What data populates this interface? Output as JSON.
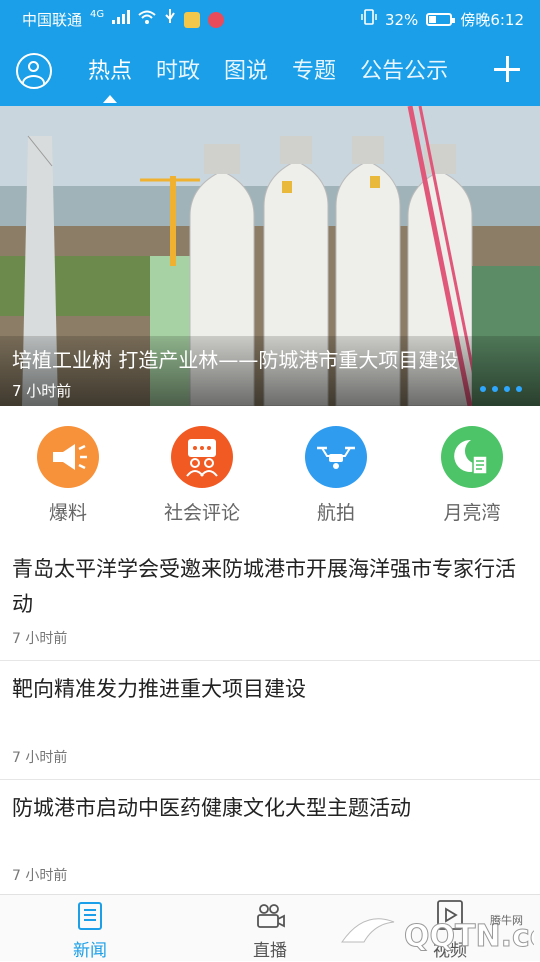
{
  "status_bar": {
    "carrier": "中国联通",
    "network": "4G",
    "battery": "32%",
    "battery_level": 0.32,
    "time": "傍晚6:12"
  },
  "nav": {
    "tabs": [
      {
        "label": "热点",
        "active": true
      },
      {
        "label": "时政",
        "active": false
      },
      {
        "label": "图说",
        "active": false
      },
      {
        "label": "专题",
        "active": false
      },
      {
        "label": "公告公示",
        "active": false
      }
    ]
  },
  "hero": {
    "title": "培植工业树 打造产业林——防城港市重大项目建设",
    "time": "7 小时前",
    "slides": 4
  },
  "quick_links": [
    {
      "label": "爆料",
      "icon": "megaphone-icon",
      "color": "#f7913a"
    },
    {
      "label": "社会评论",
      "icon": "comment-icon",
      "color": "#f25a24"
    },
    {
      "label": "航拍",
      "icon": "drone-icon",
      "color": "#2f9cf0"
    },
    {
      "label": "月亮湾",
      "icon": "moon-icon",
      "color": "#4cc467"
    }
  ],
  "news": [
    {
      "title": "青岛太平洋学会受邀来防城港市开展海洋强市专家行活动",
      "time": "7 小时前"
    },
    {
      "title": "靶向精准发力推进重大项目建设",
      "time": "7 小时前"
    },
    {
      "title": "防城港市启动中医药健康文化大型主题活动",
      "time": "7 小时前"
    }
  ],
  "bottom_tabs": [
    {
      "label": "新闻",
      "active": true
    },
    {
      "label": "直播",
      "active": false
    },
    {
      "label": "视频",
      "active": false
    }
  ],
  "watermark": {
    "text": "QQTN.com",
    "sub": "腾牛网"
  },
  "colors": {
    "brand": "#1a9fe8",
    "text": "#222222",
    "muted": "#777777"
  }
}
